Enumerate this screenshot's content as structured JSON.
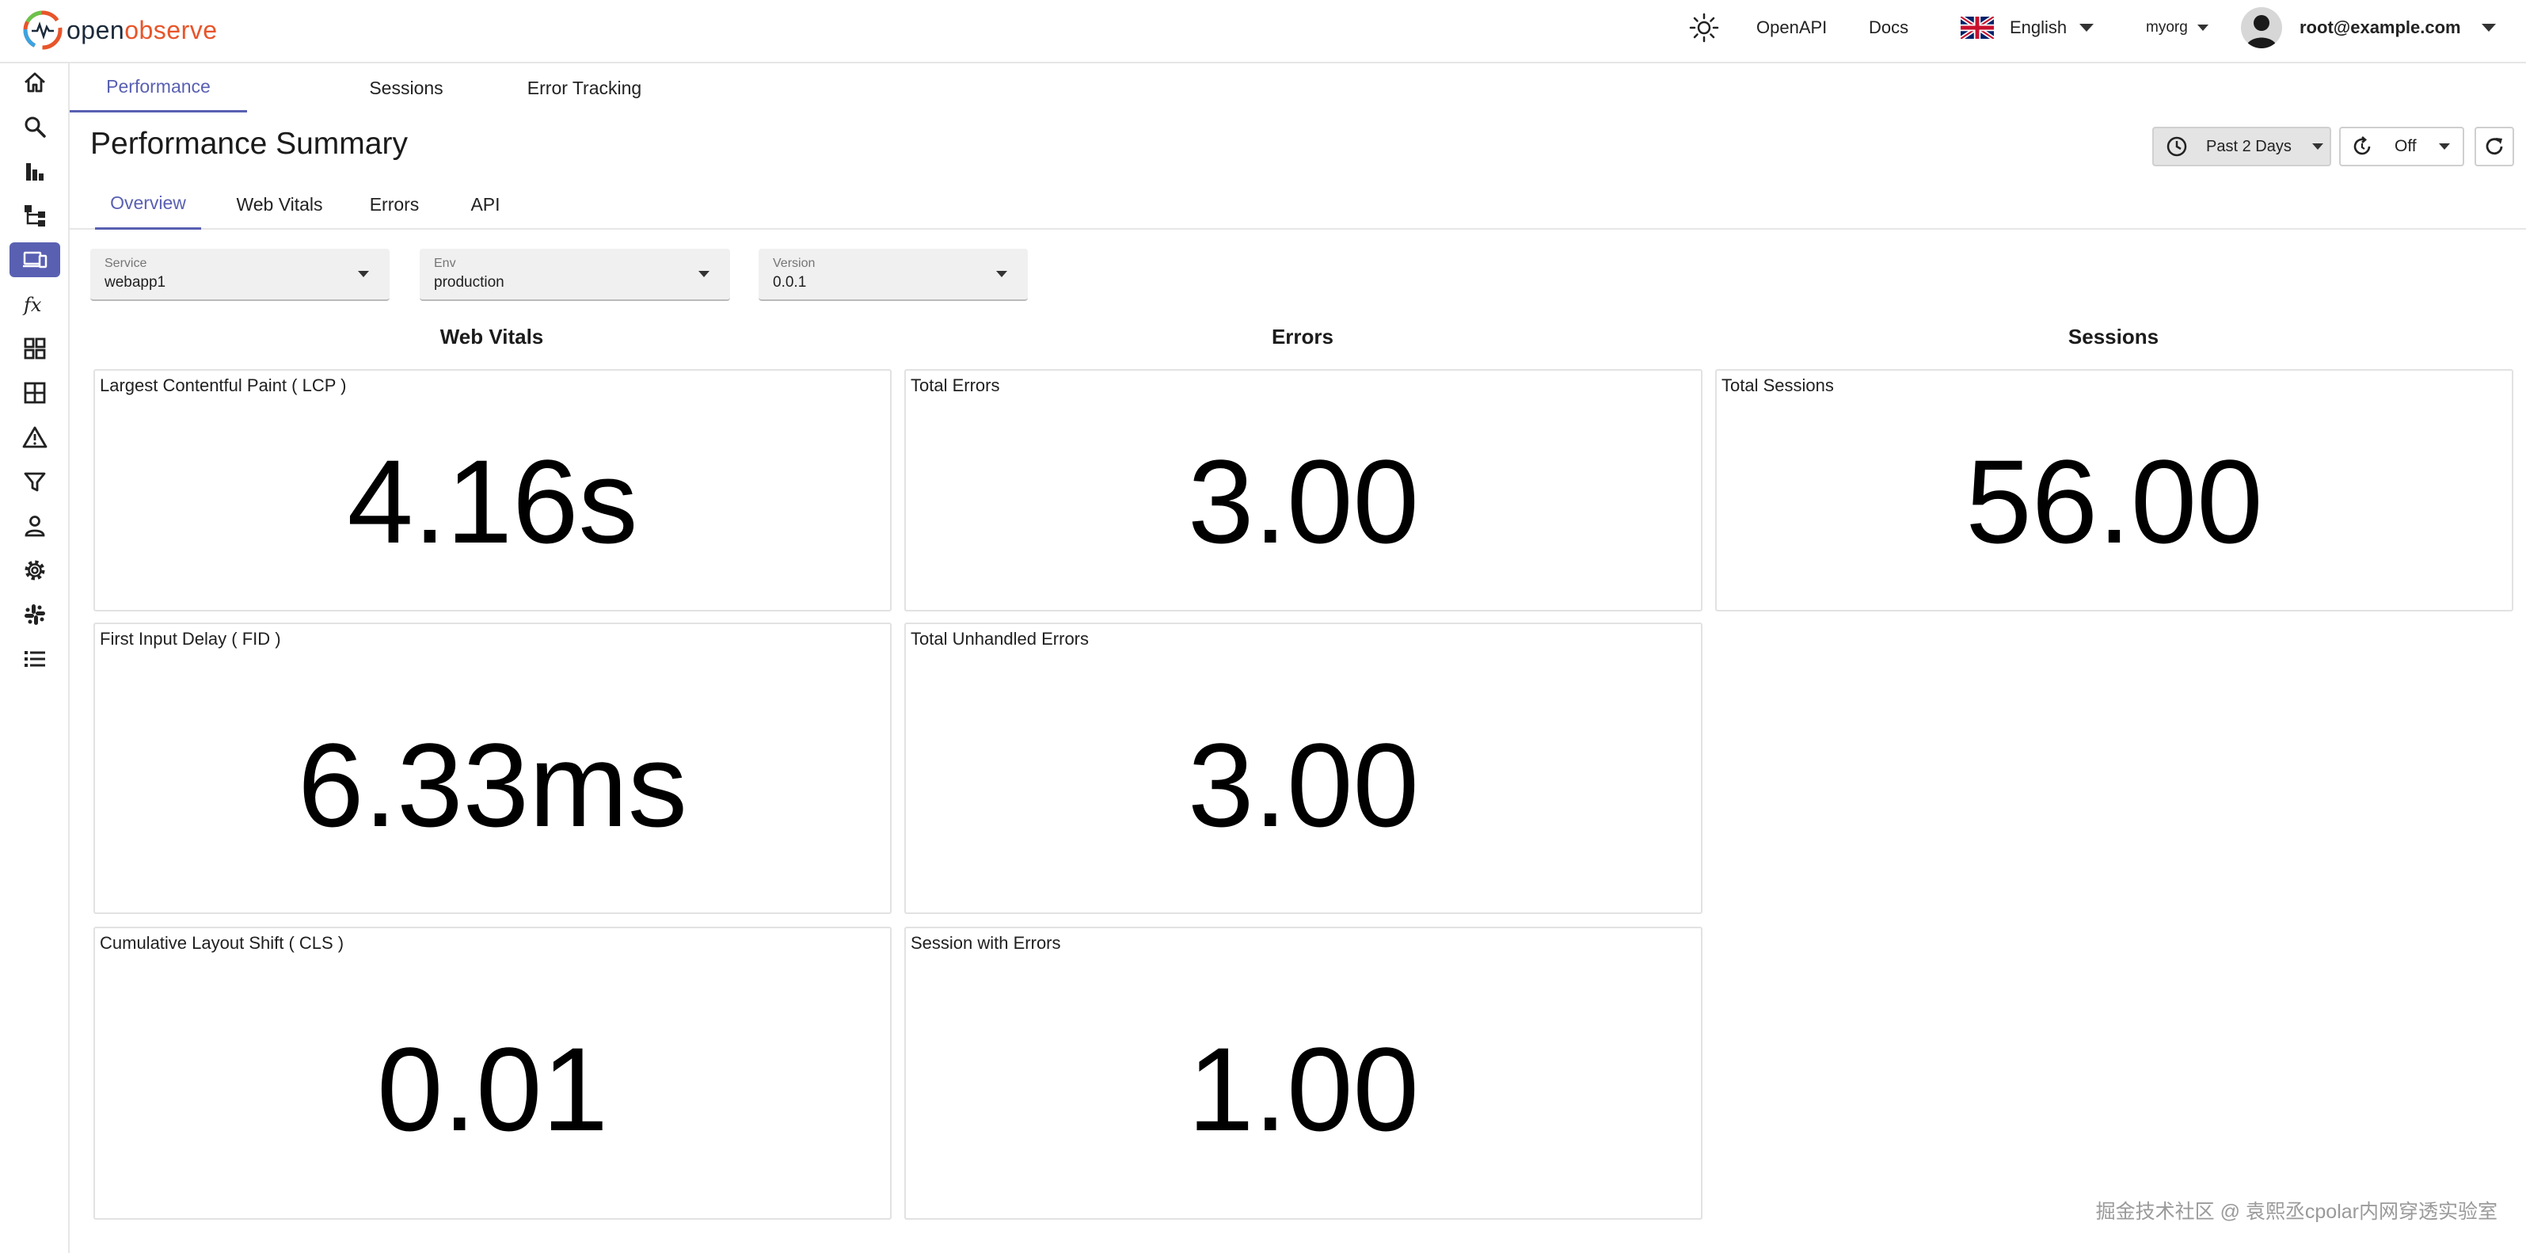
{
  "header": {
    "logo": {
      "part1": "open",
      "part2": "observe"
    },
    "openapi_label": "OpenAPI",
    "docs_label": "Docs",
    "language": "English",
    "org": "myorg",
    "user": "root@example.com"
  },
  "sidebar": {
    "items": [
      {
        "icon": "home-icon"
      },
      {
        "icon": "search-icon"
      },
      {
        "icon": "bar-chart-icon"
      },
      {
        "icon": "traces-icon"
      },
      {
        "icon": "rum-devices-icon",
        "active": true
      },
      {
        "icon": "function-icon"
      },
      {
        "icon": "dashboards-icon"
      },
      {
        "icon": "streams-icon"
      },
      {
        "icon": "alert-icon"
      },
      {
        "icon": "filter-icon"
      },
      {
        "icon": "user-icon"
      },
      {
        "icon": "settings-icon"
      },
      {
        "icon": "slack-icon"
      },
      {
        "icon": "list-icon"
      }
    ]
  },
  "top_tabs": [
    {
      "label": "Performance",
      "active": true
    },
    {
      "label": "Sessions"
    },
    {
      "label": "Error Tracking"
    }
  ],
  "page_title": "Performance Summary",
  "controls": {
    "time_range": "Past 2 Days",
    "refresh": "Off"
  },
  "sub_tabs": [
    {
      "label": "Overview",
      "active": true
    },
    {
      "label": "Web Vitals"
    },
    {
      "label": "Errors"
    },
    {
      "label": "API"
    }
  ],
  "filters": [
    {
      "label": "Service",
      "value": "webapp1"
    },
    {
      "label": "Env",
      "value": "production"
    },
    {
      "label": "Version",
      "value": "0.0.1"
    }
  ],
  "columns": {
    "web_vitals": {
      "title": "Web Vitals",
      "panels": [
        {
          "title": "Largest Contentful Paint ( LCP )",
          "value": "4.16s"
        },
        {
          "title": "First Input Delay ( FID )",
          "value": "6.33ms"
        },
        {
          "title": "Cumulative Layout Shift ( CLS )",
          "value": "0.01"
        }
      ]
    },
    "errors": {
      "title": "Errors",
      "panels": [
        {
          "title": "Total Errors",
          "value": "3.00"
        },
        {
          "title": "Total Unhandled Errors",
          "value": "3.00"
        },
        {
          "title": "Session with Errors",
          "value": "1.00"
        }
      ]
    },
    "sessions": {
      "title": "Sessions",
      "panels": [
        {
          "title": "Total Sessions",
          "value": "56.00"
        }
      ]
    }
  },
  "watermark": "掘金技术社区 @ 袁熙丞cpolar内网穿透实验室",
  "colors": {
    "accent": "#5960b2",
    "logo_dark": "#1b2a3a",
    "logo_orange": "#e8552a"
  }
}
